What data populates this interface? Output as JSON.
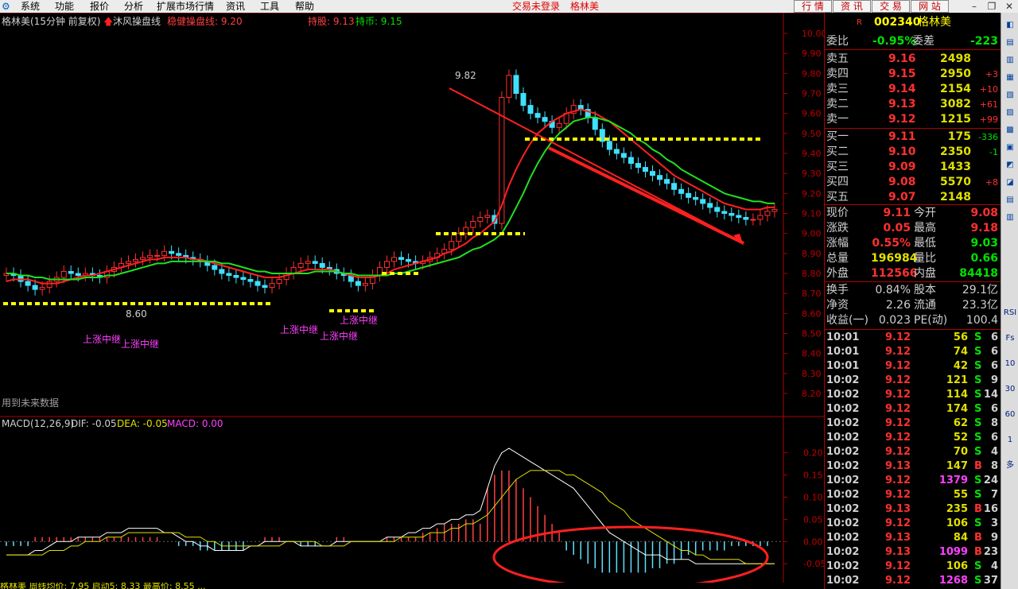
{
  "menubar": {
    "items": [
      "系统",
      "功能",
      "报价",
      "分析",
      "扩展市场行情",
      "资讯",
      "工具",
      "帮助"
    ],
    "status": "交易未登录",
    "stock_name": "格林美",
    "tabs": [
      "行 情",
      "资 讯",
      "交 易",
      "网 站"
    ]
  },
  "chart_header": {
    "stock": "格林美(15分钟 前复权)",
    "indicator": "沐风操盘线",
    "stable": "稳健操盘线: 9.20",
    "hold": "持股: 9.13",
    "hold_coin": "持币: 9.15",
    "future_note": "用到未来数据",
    "high_label": "9.82",
    "low_label": "8.60",
    "signals": [
      "上涨中继",
      "上涨中继",
      "上涨中继",
      "上涨中继",
      "上涨中继"
    ]
  },
  "price_axis": [
    "10.00",
    "9.90",
    "9.80",
    "9.70",
    "9.60",
    "9.50",
    "9.40",
    "9.30",
    "9.20",
    "9.10",
    "9.00",
    "8.90",
    "8.80",
    "8.70",
    "8.60",
    "8.50",
    "8.40",
    "8.30",
    "8.20"
  ],
  "macd_header": {
    "name": "MACD(12,26,9)",
    "dif": "DIF: -0.05",
    "dea": "DEA: -0.05",
    "macd": "MACD: 0.00"
  },
  "macd_axis": [
    "0.20",
    "0.15",
    "0.10",
    "0.05",
    "0.00",
    "-0.05"
  ],
  "chart_data": {
    "type": "line",
    "price_range": [
      8.2,
      10.0
    ],
    "macd_range": [
      -0.08,
      0.21
    ],
    "closes": [
      8.8,
      8.79,
      8.76,
      8.74,
      8.72,
      8.73,
      8.76,
      8.78,
      8.81,
      8.8,
      8.79,
      8.8,
      8.79,
      8.78,
      8.81,
      8.83,
      8.85,
      8.86,
      8.87,
      8.88,
      8.89,
      8.89,
      8.91,
      8.9,
      8.89,
      8.88,
      8.87,
      8.86,
      8.84,
      8.82,
      8.8,
      8.79,
      8.78,
      8.77,
      8.76,
      8.74,
      8.73,
      8.75,
      8.77,
      8.8,
      8.83,
      8.85,
      8.86,
      8.85,
      8.83,
      8.82,
      8.8,
      8.79,
      8.76,
      8.74,
      8.75,
      8.79,
      8.83,
      8.86,
      8.88,
      8.87,
      8.86,
      8.85,
      8.86,
      8.88,
      8.9,
      8.92,
      8.96,
      9.0,
      9.03,
      9.06,
      9.08,
      9.09,
      9.05,
      9.68,
      9.79,
      9.7,
      9.64,
      9.6,
      9.58,
      9.56,
      9.53,
      9.55,
      9.6,
      9.64,
      9.62,
      9.58,
      9.52,
      9.46,
      9.42,
      9.4,
      9.38,
      9.35,
      9.33,
      9.31,
      9.29,
      9.27,
      9.25,
      9.22,
      9.2,
      9.18,
      9.17,
      9.15,
      9.13,
      9.11,
      9.1,
      9.09,
      9.08,
      9.07,
      9.07,
      9.09,
      9.11,
      9.12
    ],
    "opens": [
      8.79,
      8.8,
      8.79,
      8.76,
      8.74,
      8.72,
      8.73,
      8.76,
      8.78,
      8.81,
      8.8,
      8.79,
      8.8,
      8.79,
      8.78,
      8.81,
      8.83,
      8.85,
      8.86,
      8.87,
      8.88,
      8.89,
      8.89,
      8.91,
      8.9,
      8.89,
      8.88,
      8.87,
      8.86,
      8.84,
      8.82,
      8.8,
      8.79,
      8.78,
      8.77,
      8.76,
      8.74,
      8.73,
      8.75,
      8.77,
      8.8,
      8.83,
      8.85,
      8.86,
      8.85,
      8.83,
      8.82,
      8.8,
      8.79,
      8.76,
      8.74,
      8.75,
      8.79,
      8.83,
      8.86,
      8.88,
      8.87,
      8.86,
      8.85,
      8.86,
      8.88,
      8.9,
      8.92,
      8.96,
      9.0,
      9.03,
      9.06,
      9.08,
      9.09,
      9.05,
      9.68,
      9.79,
      9.7,
      9.64,
      9.6,
      9.58,
      9.56,
      9.53,
      9.55,
      9.6,
      9.64,
      9.62,
      9.58,
      9.52,
      9.46,
      9.42,
      9.4,
      9.38,
      9.35,
      9.33,
      9.31,
      9.29,
      9.27,
      9.25,
      9.22,
      9.2,
      9.18,
      9.17,
      9.15,
      9.13,
      9.11,
      9.1,
      9.09,
      9.08,
      9.07,
      9.07,
      9.09,
      9.11
    ],
    "ma_red": [
      8.76,
      8.77,
      8.77,
      8.77,
      8.76,
      8.75,
      8.75,
      8.75,
      8.76,
      8.77,
      8.78,
      8.79,
      8.79,
      8.8,
      8.81,
      8.82,
      8.83,
      8.84,
      8.85,
      8.86,
      8.87,
      8.87,
      8.88,
      8.88,
      8.88,
      8.88,
      8.87,
      8.87,
      8.86,
      8.85,
      8.84,
      8.83,
      8.82,
      8.81,
      8.8,
      8.79,
      8.78,
      8.78,
      8.78,
      8.79,
      8.8,
      8.81,
      8.82,
      8.82,
      8.82,
      8.82,
      8.81,
      8.8,
      8.79,
      8.78,
      8.78,
      8.78,
      8.79,
      8.8,
      8.82,
      8.83,
      8.84,
      8.85,
      8.86,
      8.87,
      8.88,
      8.9,
      8.91,
      8.93,
      8.95,
      8.98,
      9.0,
      9.03,
      9.06,
      9.14,
      9.24,
      9.32,
      9.39,
      9.45,
      9.5,
      9.53,
      9.56,
      9.58,
      9.6,
      9.61,
      9.62,
      9.61,
      9.6,
      9.58,
      9.56,
      9.53,
      9.5,
      9.47,
      9.44,
      9.41,
      9.38,
      9.35,
      9.32,
      9.29,
      9.27,
      9.25,
      9.23,
      9.21,
      9.19,
      9.17,
      9.15,
      9.14,
      9.13,
      9.12,
      9.12,
      9.12,
      9.13,
      9.13
    ],
    "ma_green": [
      8.8,
      8.8,
      8.79,
      8.79,
      8.78,
      8.78,
      8.77,
      8.77,
      8.77,
      8.77,
      8.77,
      8.78,
      8.78,
      8.78,
      8.79,
      8.79,
      8.8,
      8.81,
      8.82,
      8.83,
      8.84,
      8.85,
      8.85,
      8.86,
      8.86,
      8.86,
      8.86,
      8.86,
      8.86,
      8.86,
      8.85,
      8.85,
      8.84,
      8.83,
      8.82,
      8.81,
      8.81,
      8.8,
      8.8,
      8.8,
      8.8,
      8.8,
      8.8,
      8.81,
      8.81,
      8.81,
      8.81,
      8.8,
      8.8,
      8.79,
      8.79,
      8.79,
      8.79,
      8.79,
      8.8,
      8.8,
      8.81,
      8.82,
      8.83,
      8.84,
      8.85,
      8.86,
      8.87,
      8.88,
      8.9,
      8.92,
      8.93,
      8.95,
      8.97,
      9.0,
      9.06,
      9.13,
      9.2,
      9.28,
      9.35,
      9.41,
      9.46,
      9.5,
      9.53,
      9.56,
      9.57,
      9.58,
      9.58,
      9.57,
      9.56,
      9.54,
      9.52,
      9.5,
      9.47,
      9.45,
      9.42,
      9.4,
      9.37,
      9.35,
      9.32,
      9.3,
      9.28,
      9.26,
      9.24,
      9.22,
      9.2,
      9.19,
      9.18,
      9.17,
      9.16,
      9.16,
      9.15,
      9.15
    ],
    "dif": [
      -0.03,
      -0.03,
      -0.03,
      -0.03,
      -0.02,
      -0.02,
      -0.01,
      0.0,
      0.0,
      0.0,
      0.01,
      0.01,
      0.01,
      0.01,
      0.02,
      0.02,
      0.02,
      0.03,
      0.03,
      0.03,
      0.03,
      0.03,
      0.02,
      0.02,
      0.01,
      0.0,
      0.0,
      -0.01,
      -0.01,
      -0.02,
      -0.02,
      -0.02,
      -0.02,
      -0.02,
      -0.01,
      -0.01,
      0.0,
      0.0,
      0.0,
      0.0,
      0.0,
      -0.01,
      -0.01,
      -0.01,
      -0.01,
      -0.01,
      0.0,
      0.0,
      0.0,
      0.0,
      0.0,
      0.0,
      0.0,
      0.01,
      0.01,
      0.01,
      0.02,
      0.02,
      0.03,
      0.03,
      0.04,
      0.04,
      0.05,
      0.05,
      0.06,
      0.06,
      0.07,
      0.12,
      0.17,
      0.2,
      0.21,
      0.2,
      0.19,
      0.18,
      0.17,
      0.16,
      0.15,
      0.14,
      0.13,
      0.12,
      0.1,
      0.08,
      0.06,
      0.04,
      0.02,
      0.01,
      0.0,
      -0.01,
      -0.02,
      -0.03,
      -0.03,
      -0.03,
      -0.04,
      -0.04,
      -0.04,
      -0.04,
      -0.05,
      -0.05,
      -0.05,
      -0.05,
      -0.05,
      -0.05,
      -0.05,
      -0.05,
      -0.05,
      -0.05,
      -0.05,
      -0.05
    ],
    "dea": [
      -0.03,
      -0.03,
      -0.03,
      -0.03,
      -0.03,
      -0.03,
      -0.02,
      -0.02,
      -0.02,
      -0.01,
      -0.01,
      0.0,
      0.0,
      0.0,
      0.01,
      0.01,
      0.01,
      0.02,
      0.02,
      0.02,
      0.02,
      0.02,
      0.02,
      0.02,
      0.02,
      0.01,
      0.01,
      0.01,
      0.0,
      0.0,
      -0.01,
      -0.01,
      -0.01,
      -0.01,
      -0.01,
      -0.01,
      -0.01,
      -0.01,
      -0.01,
      0.0,
      0.0,
      0.0,
      0.0,
      0.0,
      -0.01,
      -0.01,
      -0.01,
      -0.01,
      0.0,
      0.0,
      0.0,
      0.0,
      0.0,
      0.0,
      0.0,
      0.01,
      0.01,
      0.01,
      0.01,
      0.02,
      0.02,
      0.02,
      0.03,
      0.03,
      0.04,
      0.04,
      0.05,
      0.06,
      0.08,
      0.1,
      0.12,
      0.14,
      0.15,
      0.16,
      0.16,
      0.16,
      0.16,
      0.16,
      0.15,
      0.15,
      0.14,
      0.13,
      0.12,
      0.11,
      0.09,
      0.08,
      0.07,
      0.05,
      0.04,
      0.03,
      0.02,
      0.01,
      0.0,
      -0.01,
      -0.02,
      -0.02,
      -0.03,
      -0.03,
      -0.04,
      -0.04,
      -0.04,
      -0.04,
      -0.04,
      -0.05,
      -0.05,
      -0.05,
      -0.05,
      -0.05
    ],
    "macd_bars": [
      -0.01,
      -0.01,
      -0.01,
      -0.01,
      0.01,
      0.01,
      0.01,
      0.01,
      0.01,
      0.01,
      0.01,
      0.01,
      0.01,
      0.01,
      0.01,
      0.01,
      0.01,
      0.01,
      0.01,
      0.01,
      0.01,
      0.01,
      0.0,
      0.0,
      -0.01,
      -0.01,
      -0.01,
      -0.02,
      -0.02,
      -0.02,
      -0.02,
      -0.02,
      -0.02,
      -0.02,
      0.0,
      0.0,
      0.01,
      0.01,
      0.01,
      0.0,
      0.0,
      -0.01,
      -0.01,
      -0.01,
      0.0,
      0.0,
      0.01,
      0.01,
      0.0,
      0.0,
      0.0,
      0.0,
      0.0,
      0.01,
      0.01,
      0.01,
      0.01,
      0.01,
      0.02,
      0.02,
      0.03,
      0.04,
      0.04,
      0.04,
      0.05,
      0.05,
      0.04,
      0.12,
      0.15,
      0.16,
      0.16,
      0.14,
      0.12,
      0.1,
      0.08,
      0.06,
      0.04,
      0.02,
      -0.02,
      -0.03,
      -0.04,
      -0.05,
      -0.06,
      -0.07,
      -0.07,
      -0.07,
      -0.07,
      -0.07,
      -0.07,
      -0.07,
      -0.06,
      -0.06,
      -0.05,
      -0.05,
      -0.04,
      -0.03,
      -0.03,
      -0.02,
      -0.02,
      -0.02,
      -0.02,
      -0.01,
      -0.01,
      -0.01,
      -0.01,
      -0.01,
      -0.01,
      0.0
    ]
  },
  "quote": {
    "code": "002340",
    "name": "格林美",
    "weibi_label": "委比",
    "weibi": "-0.95%",
    "weicha_label": "委差",
    "weicha": "-223",
    "asks": [
      {
        "label": "卖五",
        "price": "9.16",
        "vol": "2498",
        "chg": ""
      },
      {
        "label": "卖四",
        "price": "9.15",
        "vol": "2950",
        "chg": "+3"
      },
      {
        "label": "卖三",
        "price": "9.14",
        "vol": "2154",
        "chg": "+10"
      },
      {
        "label": "卖二",
        "price": "9.13",
        "vol": "3082",
        "chg": "+61"
      },
      {
        "label": "卖一",
        "price": "9.12",
        "vol": "1215",
        "chg": "+99"
      }
    ],
    "bids": [
      {
        "label": "买一",
        "price": "9.11",
        "vol": "175",
        "chg": "-336"
      },
      {
        "label": "买二",
        "price": "9.10",
        "vol": "2350",
        "chg": "-1"
      },
      {
        "label": "买三",
        "price": "9.09",
        "vol": "1433",
        "chg": ""
      },
      {
        "label": "买四",
        "price": "9.08",
        "vol": "5570",
        "chg": "+8"
      },
      {
        "label": "买五",
        "price": "9.07",
        "vol": "2148",
        "chg": ""
      }
    ],
    "stats": [
      {
        "l1": "现价",
        "v1": "9.11",
        "l2": "今开",
        "v2": "9.08",
        "c1": "#ff3030",
        "c2": "#ff3030"
      },
      {
        "l1": "涨跌",
        "v1": "0.05",
        "l2": "最高",
        "v2": "9.18",
        "c1": "#ff3030",
        "c2": "#ff3030"
      },
      {
        "l1": "涨幅",
        "v1": "0.55%",
        "l2": "最低",
        "v2": "9.03",
        "c1": "#ff3030",
        "c2": "#00e000"
      },
      {
        "l1": "总量",
        "v1": "196984",
        "l2": "量比",
        "v2": "0.66",
        "c1": "#e0e000",
        "c2": "#00e000"
      },
      {
        "l1": "外盘",
        "v1": "112566",
        "l2": "内盘",
        "v2": "84418",
        "c1": "#ff3030",
        "c2": "#00e000"
      }
    ],
    "stats2": [
      {
        "l1": "换手",
        "v1": "0.84%",
        "l2": "股本",
        "v2": "29.1亿"
      },
      {
        "l1": "净资",
        "v1": "2.26",
        "l2": "流通",
        "v2": "23.3亿"
      },
      {
        "l1": "收益(一)",
        "v1": "0.023",
        "l2": "PE(动)",
        "v2": "100.4"
      }
    ],
    "ticks": [
      {
        "t": "10:01",
        "p": "9.12",
        "v": "56",
        "s": "S",
        "n": "6"
      },
      {
        "t": "10:01",
        "p": "9.12",
        "v": "74",
        "s": "S",
        "n": "6"
      },
      {
        "t": "10:01",
        "p": "9.12",
        "v": "42",
        "s": "S",
        "n": "6"
      },
      {
        "t": "10:02",
        "p": "9.12",
        "v": "121",
        "s": "S",
        "n": "9"
      },
      {
        "t": "10:02",
        "p": "9.12",
        "v": "114",
        "s": "S",
        "n": "14"
      },
      {
        "t": "10:02",
        "p": "9.12",
        "v": "174",
        "s": "S",
        "n": "6"
      },
      {
        "t": "10:02",
        "p": "9.12",
        "v": "62",
        "s": "S",
        "n": "8"
      },
      {
        "t": "10:02",
        "p": "9.12",
        "v": "52",
        "s": "S",
        "n": "6"
      },
      {
        "t": "10:02",
        "p": "9.12",
        "v": "70",
        "s": "S",
        "n": "4"
      },
      {
        "t": "10:02",
        "p": "9.13",
        "v": "147",
        "s": "B",
        "n": "8"
      },
      {
        "t": "10:02",
        "p": "9.12",
        "v": "1379",
        "s": "S",
        "n": "24"
      },
      {
        "t": "10:02",
        "p": "9.12",
        "v": "55",
        "s": "S",
        "n": "7"
      },
      {
        "t": "10:02",
        "p": "9.13",
        "v": "235",
        "s": "B",
        "n": "16"
      },
      {
        "t": "10:02",
        "p": "9.12",
        "v": "106",
        "s": "S",
        "n": "3"
      },
      {
        "t": "10:02",
        "p": "9.13",
        "v": "84",
        "s": "B",
        "n": "9"
      },
      {
        "t": "10:02",
        "p": "9.13",
        "v": "1099",
        "s": "B",
        "n": "23"
      },
      {
        "t": "10:02",
        "p": "9.12",
        "v": "106",
        "s": "S",
        "n": "4"
      },
      {
        "t": "10:02",
        "p": "9.12",
        "v": "1268",
        "s": "S",
        "n": "37"
      }
    ]
  },
  "toolbar": [
    "RSI",
    "Fs",
    "10",
    "30",
    "60",
    "1",
    "多"
  ],
  "statusbar": "格林美 周线均价: 7.95  启动5: 8.33  最高价: 8.55 ..."
}
